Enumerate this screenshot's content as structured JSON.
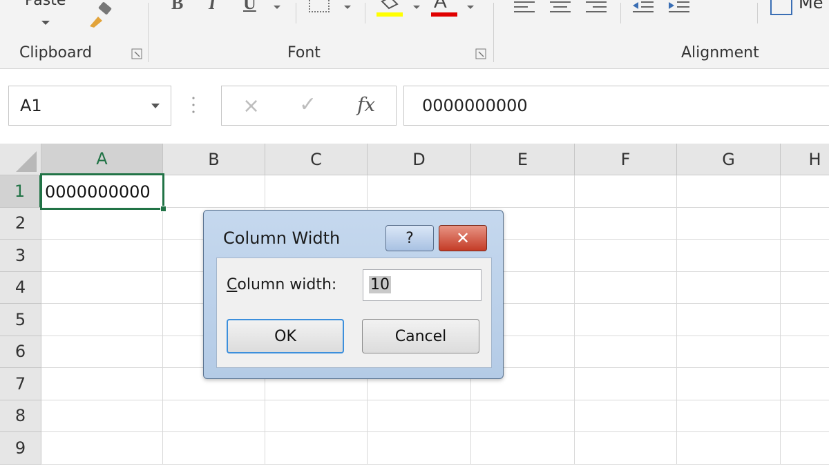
{
  "ribbon": {
    "paste_label": "Paste",
    "groups": {
      "clipboard": "Clipboard",
      "font": "Font",
      "alignment": "Alignment"
    },
    "bold_label": "B",
    "italic_label": "I",
    "underline_label": "U",
    "font_color_label": "A",
    "merge_label": "Me",
    "colors": {
      "fill_highlight": "#ffff00",
      "font_color": "#e00000",
      "accent": "#217346"
    }
  },
  "formula_bar": {
    "name_box": "A1",
    "cancel_icon": "×",
    "enter_icon": "✓",
    "fx_label": "fx",
    "formula_value": "0000000000"
  },
  "grid": {
    "column_headers": [
      "A",
      "B",
      "C",
      "D",
      "E",
      "F",
      "G",
      "H"
    ],
    "row_headers": [
      "1",
      "2",
      "3",
      "4",
      "5",
      "6",
      "7",
      "8",
      "9"
    ],
    "active_cell": "A1",
    "cell_a1": "0000000000"
  },
  "dialog": {
    "title": "Column Width",
    "help_label": "?",
    "close_label": "✕",
    "field_label_accel": "C",
    "field_label_rest": "olumn width:",
    "width_value": "10",
    "ok_label": "OK",
    "cancel_label": "Cancel"
  }
}
